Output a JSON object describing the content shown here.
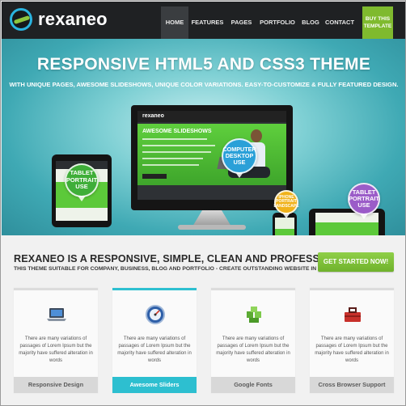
{
  "brand": {
    "name": "rexaneo"
  },
  "nav": {
    "items": [
      {
        "label": "HOME",
        "active": true
      },
      {
        "label": "FEATURES",
        "active": false
      },
      {
        "label": "PAGES",
        "active": false
      },
      {
        "label": "PORTFOLIO",
        "active": false
      },
      {
        "label": "BLOG",
        "active": false
      },
      {
        "label": "CONTACT",
        "active": false
      }
    ],
    "buy_line1": "BUY THIS",
    "buy_line2": "TEMPLATE"
  },
  "hero": {
    "title": "RESPONSIVE HTML5 AND CSS3 THEME",
    "subtitle": "WITH UNIQUE PAGES, AWESOME SLIDESHOWS, UNIQUE COLOR VARIATIONS. EASY-TO-CUSTOMIZE & FULLY FEATURED DESIGN.",
    "screen_logo": "rexaneo",
    "screen_title": "AWESOME SLIDESHOWS",
    "bubbles": {
      "tablet_left": [
        "TABLET",
        "PORTRAIT",
        "USE"
      ],
      "computer": [
        "COMPUTER",
        "DESKTOP",
        "USE"
      ],
      "phone": [
        "IPHONE",
        "PORTRAIT",
        "LANDSCAPE"
      ],
      "tablet_right": [
        "TABLET",
        "PORTRAIT",
        "USE"
      ]
    }
  },
  "intro": {
    "title": "REXANEO IS A RESPONSIVE, SIMPLE, CLEAN AND PROFESSIONAL",
    "subtitle": "THIS THEME SUITABLE FOR COMPANY, BUSINESS, BLOG AND PORTFOLIO - CREATE OUTSTANDING WEBSITE IN MINUTES!",
    "cta_label": "GET STARTED NOW!"
  },
  "features": [
    {
      "icon": "laptop-icon",
      "text": "There are many variations of passages of Lorem Ipsum but the majority have suffered alteration in words",
      "label": "Responsive Design",
      "active": false
    },
    {
      "icon": "speedometer-icon",
      "text": "There are many variations of passages of Lorem Ipsum but the majority have suffered alteration in words",
      "label": "Awesome Sliders",
      "active": true
    },
    {
      "icon": "puzzle-icon",
      "text": "There are many variations of passages of Lorem Ipsum but the majority have suffered alteration in words",
      "label": "Google Fonts",
      "active": false
    },
    {
      "icon": "toolbox-icon",
      "text": "There are many variations of passages of Lorem Ipsum but the majority have suffered alteration in words",
      "label": "Cross Browser Support",
      "active": false
    }
  ],
  "colors": {
    "accent_green": "#7fba2e",
    "accent_cyan": "#2dbfd0",
    "nav_bg": "#1f2123"
  }
}
